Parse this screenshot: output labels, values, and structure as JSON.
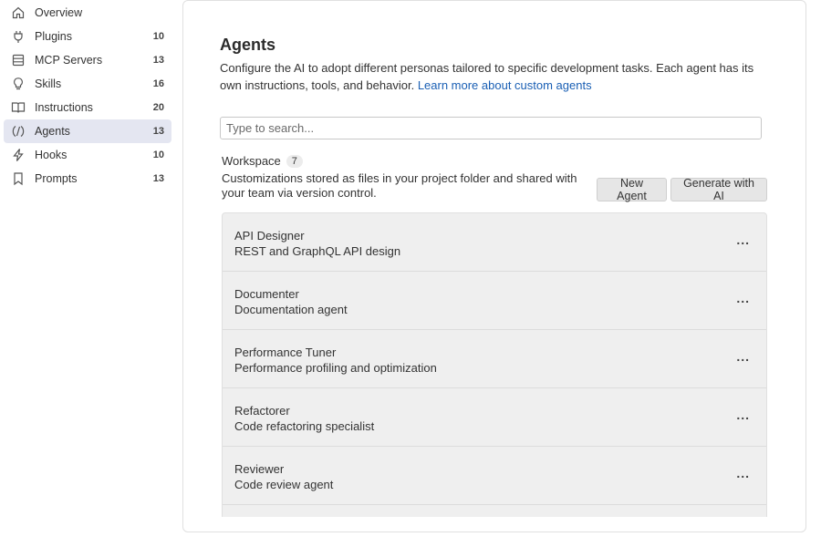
{
  "sidebar": {
    "items": [
      {
        "label": "Overview",
        "count": "",
        "icon": "home-icon"
      },
      {
        "label": "Plugins",
        "count": "10",
        "icon": "plug-icon"
      },
      {
        "label": "MCP Servers",
        "count": "13",
        "icon": "server-icon"
      },
      {
        "label": "Skills",
        "count": "16",
        "icon": "lightbulb-icon"
      },
      {
        "label": "Instructions",
        "count": "20",
        "icon": "book-icon"
      },
      {
        "label": "Agents",
        "count": "13",
        "icon": "agent-icon",
        "active": true
      },
      {
        "label": "Hooks",
        "count": "10",
        "icon": "lightning-icon"
      },
      {
        "label": "Prompts",
        "count": "13",
        "icon": "bookmark-icon"
      }
    ]
  },
  "main": {
    "title": "Agents",
    "description": "Configure the AI to adopt different personas tailored to specific development tasks. Each agent has its own instructions, tools, and behavior.",
    "learn_more": "Learn more about custom agents",
    "search_placeholder": "Type to search...",
    "section": {
      "title": "Workspace",
      "count": "7",
      "description": "Customizations stored as files in your project folder and shared with your team via version control.",
      "new_button": "New Agent",
      "generate_button": "Generate with AI"
    },
    "agents": [
      {
        "name": "API Designer",
        "description": "REST and GraphQL API design"
      },
      {
        "name": "Documenter",
        "description": "Documentation agent"
      },
      {
        "name": "Performance Tuner",
        "description": "Performance profiling and optimization"
      },
      {
        "name": "Refactorer",
        "description": "Code refactoring specialist"
      },
      {
        "name": "Reviewer",
        "description": "Code review agent"
      }
    ],
    "more_label": "..."
  },
  "colors": {
    "active_bg": "#e4e6f1",
    "link": "#1a5fb4",
    "list_bg": "#efefef"
  }
}
